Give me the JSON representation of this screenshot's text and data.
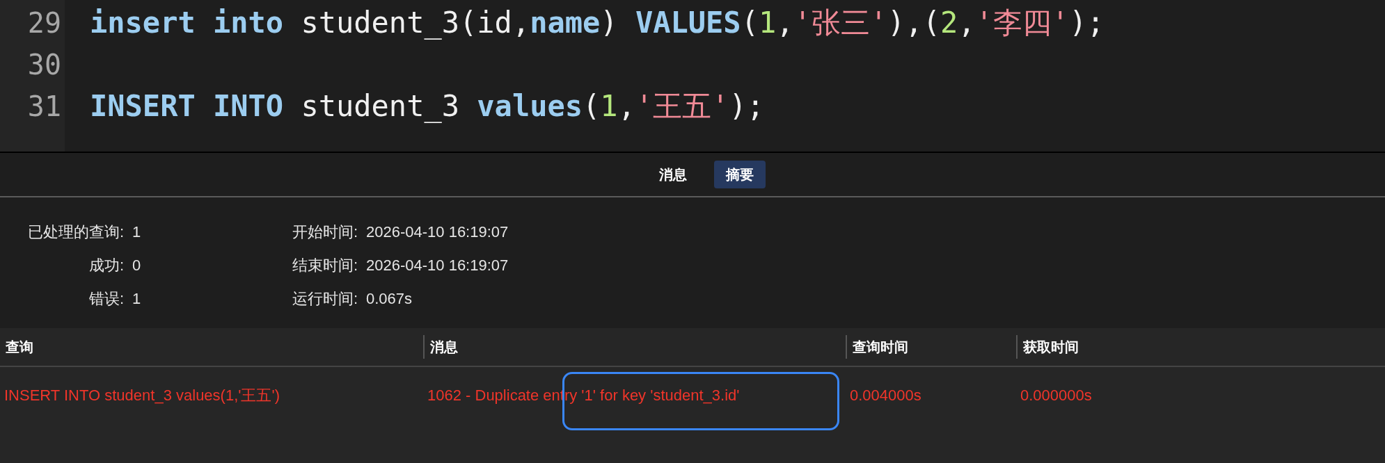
{
  "editor": {
    "lines": [
      {
        "number": "29",
        "tokens": [
          {
            "kind": "keyword",
            "text": "insert into"
          },
          {
            "kind": "plain",
            "text": " student_3(id,"
          },
          {
            "kind": "keyword",
            "text": "name"
          },
          {
            "kind": "plain",
            "text": ") "
          },
          {
            "kind": "keyword",
            "text": "VALUES"
          },
          {
            "kind": "plain",
            "text": "("
          },
          {
            "kind": "number",
            "text": "1"
          },
          {
            "kind": "plain",
            "text": ","
          },
          {
            "kind": "string",
            "text": "'张三'"
          },
          {
            "kind": "plain",
            "text": "),("
          },
          {
            "kind": "number",
            "text": "2"
          },
          {
            "kind": "plain",
            "text": ","
          },
          {
            "kind": "string",
            "text": "'李四'"
          },
          {
            "kind": "plain",
            "text": ");"
          }
        ]
      },
      {
        "number": "30"
      },
      {
        "number": "31",
        "tokens": [
          {
            "kind": "keyword",
            "text": "INSERT INTO"
          },
          {
            "kind": "plain",
            "text": " student_3 "
          },
          {
            "kind": "keyword",
            "text": "values"
          },
          {
            "kind": "plain",
            "text": "("
          },
          {
            "kind": "number",
            "text": "1"
          },
          {
            "kind": "plain",
            "text": ","
          },
          {
            "kind": "string",
            "text": "'王五'"
          },
          {
            "kind": "plain",
            "text": ");"
          }
        ]
      }
    ]
  },
  "tabs": [
    {
      "label": "消息",
      "selected": false
    },
    {
      "label": "摘要",
      "selected": true
    }
  ],
  "summary": {
    "left": [
      {
        "label": "已处理的查询:",
        "value": "1"
      },
      {
        "label": "成功:",
        "value": "0"
      },
      {
        "label": "错误:",
        "value": "1"
      }
    ],
    "right": [
      {
        "label": "开始时间:",
        "value": "2026-04-10 16:19:07"
      },
      {
        "label": "结束时间:",
        "value": "2026-04-10 16:19:07"
      },
      {
        "label": "运行时间:",
        "value": "0.067s"
      }
    ]
  },
  "table": {
    "columns": [
      "查询",
      "消息",
      "查询时间",
      "获取时间"
    ],
    "rows": [
      {
        "error": true,
        "cells": [
          "INSERT INTO student_3 values(1,'王五')",
          "1062 - Duplicate entry '1' for key 'student_3.id'",
          "0.004000s",
          "0.000000s"
        ]
      }
    ]
  }
}
